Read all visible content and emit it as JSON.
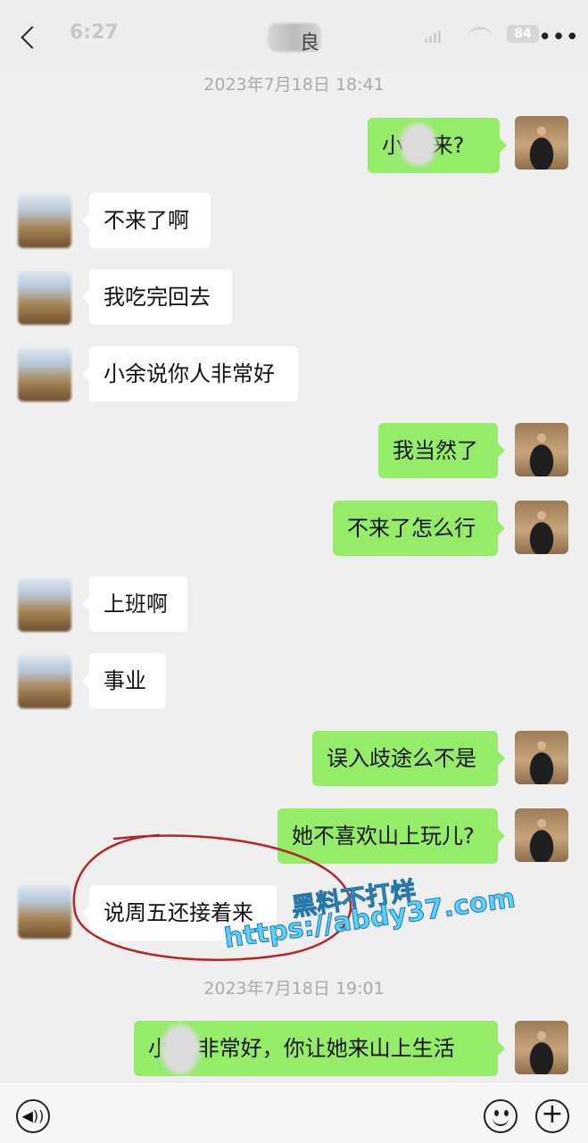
{
  "status_bar": {
    "time": "6:27",
    "battery": "84"
  },
  "header": {
    "contact_name_partial": "良",
    "back_icon": "chevron-left-icon",
    "more_icon": "ellipsis-icon"
  },
  "timestamps": [
    "2023年7月18日 18:41",
    "2023年7月18日 19:01"
  ],
  "messages": [
    {
      "sender": "self",
      "text_visible": "小  还来?"
    },
    {
      "sender": "other",
      "text": "不来了啊"
    },
    {
      "sender": "other",
      "text": "我吃完回去"
    },
    {
      "sender": "other",
      "text": "小余说你人非常好"
    },
    {
      "sender": "self",
      "text": "我当然了"
    },
    {
      "sender": "self",
      "text": "不来了怎么行"
    },
    {
      "sender": "other",
      "text": "上班啊"
    },
    {
      "sender": "other",
      "text": "事业"
    },
    {
      "sender": "self",
      "text": "误入歧途么不是"
    },
    {
      "sender": "self",
      "text": "她不喜欢山上玩儿?"
    },
    {
      "sender": "other",
      "text": "说周五还接着来"
    },
    {
      "sender": "self",
      "text_visible": "小  人非常好，你让她来山上生活"
    }
  ],
  "watermark": {
    "line1": "黑料不打烊",
    "line2": "https://abdy37.com"
  },
  "input_bar": {
    "voice_icon": "voice-icon",
    "emoji_icon": "emoji-icon",
    "plus_icon": "plus-icon"
  },
  "colors": {
    "outgoing_bubble": "#95ec69",
    "incoming_bubble": "#ffffff",
    "background": "#efefef",
    "annotation": "#b3262c"
  }
}
